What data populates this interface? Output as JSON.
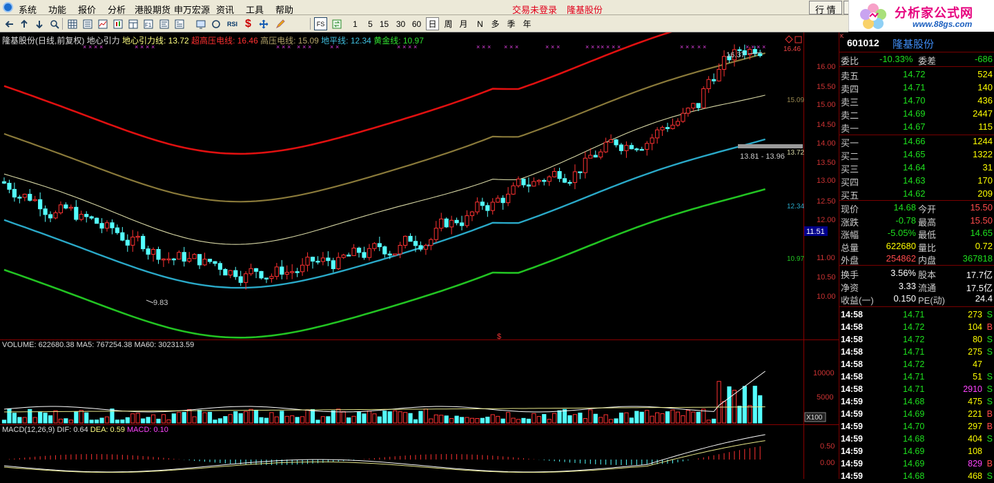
{
  "menu": [
    "系统",
    "功能",
    "报价",
    "分析",
    "港股期货",
    "申万宏源",
    "资讯",
    "工具",
    "帮助"
  ],
  "status": {
    "login": "交易未登录",
    "stock_name": "隆基股份"
  },
  "window_tabs": [
    "行 情",
    "资"
  ],
  "banner": {
    "title": "分析家公式网",
    "url": "www.88gs.com"
  },
  "toolbar": {
    "periods": [
      "1",
      "5",
      "15",
      "30",
      "60",
      "日",
      "周",
      "月",
      "N",
      "多",
      "季",
      "年"
    ],
    "active_period": "日",
    "rsi": "RSI",
    "fs": "FS"
  },
  "chart": {
    "legend": {
      "title": "隆基股份(日线,前复权) 地心引力",
      "dx": "地心引力线: 13.72",
      "cg": "超高压电线: 16.46",
      "gy": "高压电线: 15.09",
      "dp": "地平线: 12.34",
      "hj": "黄金线: 10.97"
    },
    "price_axis": [
      "16.00",
      "15.50",
      "15.00",
      "14.50",
      "14.00",
      "13.50",
      "13.00",
      "12.50",
      "12.00",
      "11.50",
      "11.00",
      "10.50",
      "10.00"
    ],
    "right_labels": {
      "top": "16.46",
      "gy": "15.09",
      "dx": "13.72",
      "dp": "12.34",
      "hj": "10.97",
      "cursor": "11.51"
    },
    "high_mark": "16.37",
    "low_mark": "9.83",
    "range_mark": "13.81 - 13.96",
    "dollar": "$",
    "volume_legend": {
      "v": "VOLUME: 622680.38",
      "ma5": "MA5: 767254.38",
      "ma60": "MA60: 302313.59"
    },
    "volume_axis": [
      "10000",
      "5000"
    ],
    "volume_unit": "X100",
    "macd_legend": {
      "name": "MACD(12,26,9)",
      "dif": "DIF: 0.64",
      "dea": "DEA: 0.59",
      "macd": "MACD: 0.10"
    },
    "macd_axis": [
      "0.50",
      "0.00"
    ],
    "colors": {
      "up": "#ff3232",
      "down": "#54ffff",
      "cg": "#e01010",
      "gy": "#8a7a3a",
      "dp": "#2aa9c8",
      "hj": "#22c322",
      "dx": "#d9d9a6"
    }
  },
  "panel": {
    "code": "601012",
    "name": "隆基股份",
    "weibi": {
      "label": "委比",
      "value": "-10.33%",
      "label2": "委差",
      "value2": "-686"
    },
    "sell": [
      {
        "label": "卖五",
        "price": "14.72",
        "vol": "524"
      },
      {
        "label": "卖四",
        "price": "14.71",
        "vol": "140"
      },
      {
        "label": "卖三",
        "price": "14.70",
        "vol": "436"
      },
      {
        "label": "卖二",
        "price": "14.69",
        "vol": "2447"
      },
      {
        "label": "卖一",
        "price": "14.67",
        "vol": "115"
      }
    ],
    "buy": [
      {
        "label": "买一",
        "price": "14.66",
        "vol": "1244"
      },
      {
        "label": "买二",
        "price": "14.65",
        "vol": "1322"
      },
      {
        "label": "买三",
        "price": "14.64",
        "vol": "31"
      },
      {
        "label": "买四",
        "price": "14.63",
        "vol": "170"
      },
      {
        "label": "买五",
        "price": "14.62",
        "vol": "209"
      }
    ],
    "quote": [
      {
        "l1": "现价",
        "v1": "14.68",
        "c1": "green",
        "l2": "今开",
        "v2": "15.50",
        "c2": "red"
      },
      {
        "l1": "涨跌",
        "v1": "-0.78",
        "c1": "green",
        "l2": "最高",
        "v2": "15.50",
        "c2": "red"
      },
      {
        "l1": "涨幅",
        "v1": "-5.05%",
        "c1": "green",
        "l2": "最低",
        "v2": "14.65",
        "c2": "green"
      },
      {
        "l1": "总量",
        "v1": "622680",
        "c1": "yellow",
        "l2": "量比",
        "v2": "0.72",
        "c2": "yellow"
      },
      {
        "l1": "外盘",
        "v1": "254862",
        "c1": "red",
        "l2": "内盘",
        "v2": "367818",
        "c2": "green"
      }
    ],
    "fund": [
      {
        "l1": "换手",
        "v1": "3.56%",
        "l2": "股本",
        "v2": "17.7亿"
      },
      {
        "l1": "净资",
        "v1": "3.33",
        "l2": "流通",
        "v2": "17.5亿"
      },
      {
        "l1": "收益(一)",
        "v1": "0.150",
        "l2": "PE(动)",
        "v2": "24.4"
      }
    ],
    "ticks": [
      {
        "t": "14:58",
        "p": "14.71",
        "v": "273",
        "s": "S",
        "vc": "yellow"
      },
      {
        "t": "14:58",
        "p": "14.72",
        "v": "104",
        "s": "B",
        "vc": "yellow"
      },
      {
        "t": "14:58",
        "p": "14.72",
        "v": "80",
        "s": "S",
        "vc": "yellow"
      },
      {
        "t": "14:58",
        "p": "14.71",
        "v": "275",
        "s": "S",
        "vc": "yellow"
      },
      {
        "t": "14:58",
        "p": "14.72",
        "v": "47",
        "s": "",
        "vc": "yellow"
      },
      {
        "t": "14:58",
        "p": "14.71",
        "v": "51",
        "s": "S",
        "vc": "yellow"
      },
      {
        "t": "14:58",
        "p": "14.71",
        "v": "2910",
        "s": "S",
        "vc": "purple"
      },
      {
        "t": "14:59",
        "p": "14.68",
        "v": "475",
        "s": "S",
        "vc": "yellow"
      },
      {
        "t": "14:59",
        "p": "14.69",
        "v": "221",
        "s": "B",
        "vc": "yellow"
      },
      {
        "t": "14:59",
        "p": "14.70",
        "v": "297",
        "s": "B",
        "vc": "yellow"
      },
      {
        "t": "14:59",
        "p": "14.68",
        "v": "404",
        "s": "S",
        "vc": "yellow"
      },
      {
        "t": "14:59",
        "p": "14.69",
        "v": "108",
        "s": "",
        "vc": "yellow"
      },
      {
        "t": "14:59",
        "p": "14.69",
        "v": "829",
        "s": "B",
        "vc": "purple"
      },
      {
        "t": "14:59",
        "p": "14.68",
        "v": "468",
        "s": "S",
        "vc": "yellow"
      }
    ]
  }
}
